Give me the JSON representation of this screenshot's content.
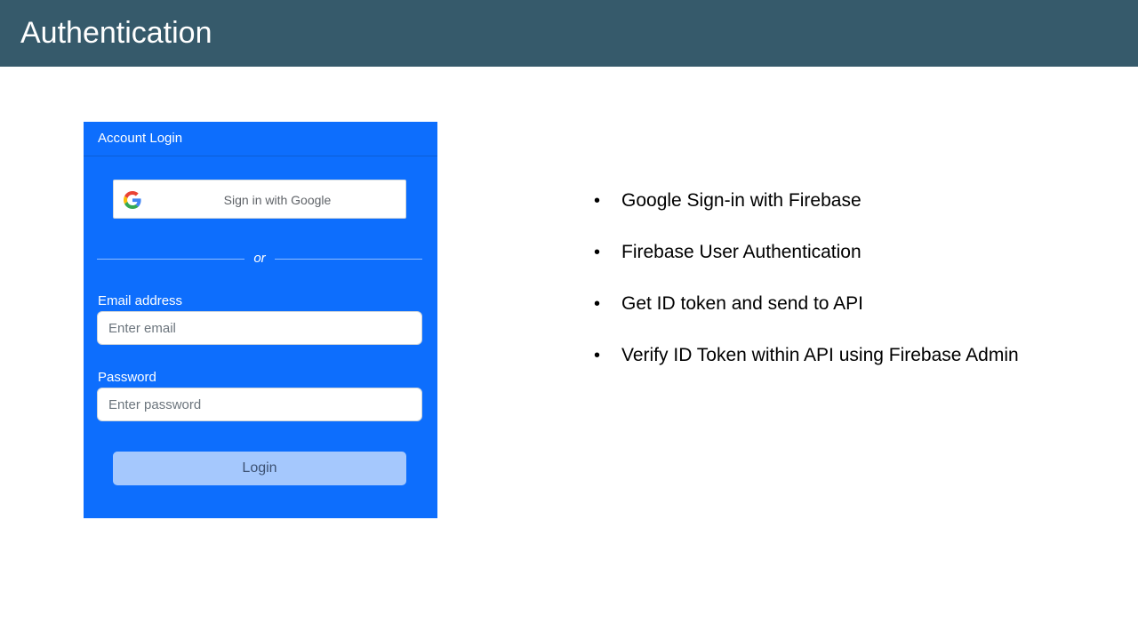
{
  "slide": {
    "title": "Authentication"
  },
  "login_card": {
    "header": "Account Login",
    "google_button_label": "Sign in with Google",
    "divider_text": "or",
    "email_label": "Email address",
    "email_placeholder": "Enter email",
    "email_value": "",
    "password_label": "Password",
    "password_placeholder": "Enter password",
    "password_value": "",
    "login_button_label": "Login"
  },
  "bullets": {
    "items": [
      {
        "text": "Google Sign-in with Firebase"
      },
      {
        "text": "Firebase User Authentication"
      },
      {
        "text": "Get ID token and send to API"
      },
      {
        "text": "Verify ID Token within API using Firebase Admin"
      }
    ],
    "marker": "•"
  },
  "colors": {
    "title_bar": "#365a6b",
    "card_background": "#0d6efd",
    "login_button": "#a5c8fd",
    "google_blue": "#4285F4",
    "google_red": "#EA4335",
    "google_yellow": "#FBBC05",
    "google_green": "#34A853"
  },
  "icons": {
    "google": "google-g-logo"
  }
}
